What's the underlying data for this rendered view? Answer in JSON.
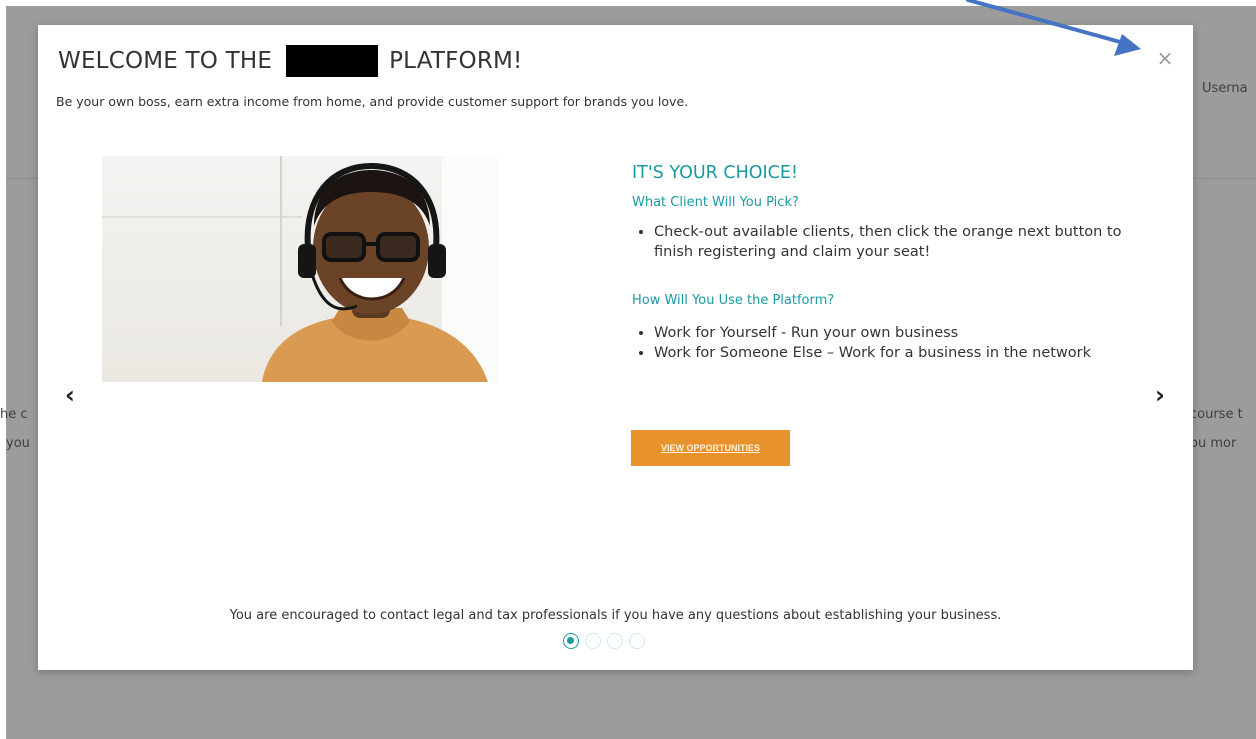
{
  "background": {
    "username_label": "Userna",
    "left_line1": "he c",
    "left_line2": "you",
    "right_line1": "course t",
    "right_line2": "ou mor"
  },
  "modal": {
    "title_prefix": "WELCOME TO THE",
    "title_suffix": "PLATFORM!",
    "close_icon": "×",
    "subtitle": "Be your own boss, earn extra income from home, and provide customer support for brands you love.",
    "slide": {
      "heading": "IT'S YOUR CHOICE!",
      "q1": "What Client Will You Pick?",
      "q1_bullets": [
        "Check-out available clients, then click the orange next button to finish registering and claim your seat!"
      ],
      "q2": "How Will You Use the Platform?",
      "q2_bullets": [
        "Work for Yourself - Run your own business",
        "Work for Someone Else – Work for a business in the network"
      ],
      "cta_label": "VIEW OPPORTUNITIES"
    },
    "prev_icon": "‹",
    "next_icon": "›",
    "footnote": "You are encouraged to contact legal and tax professionals if you have any questions about establishing your business.",
    "pagination": {
      "total": 4,
      "active": 1
    }
  },
  "colors": {
    "accent_teal": "#1a9aa0",
    "cta_orange": "#e8922c",
    "overlay_gray": "#9c9c9c",
    "annotation_blue": "#4472c4"
  }
}
